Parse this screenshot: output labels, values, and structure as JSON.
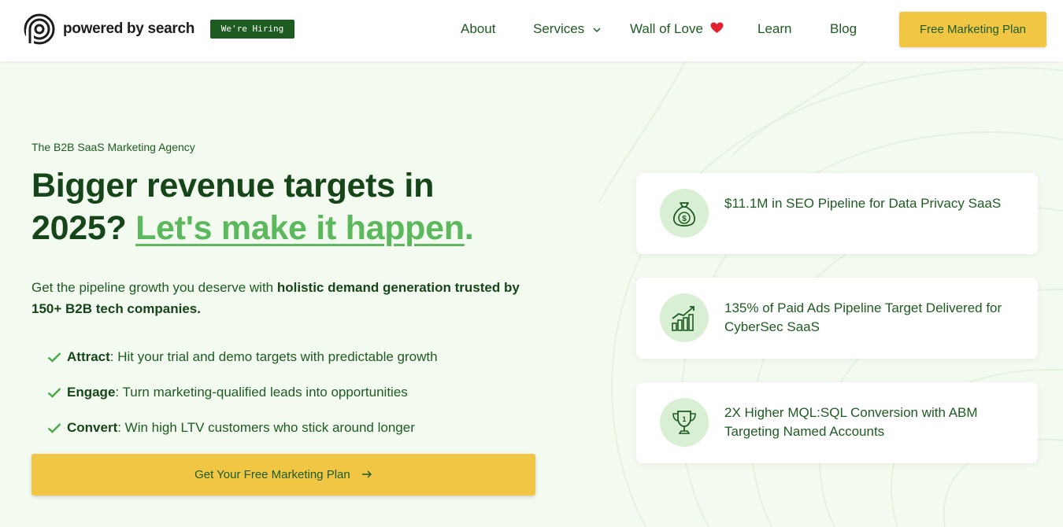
{
  "header": {
    "logo_text": "powered by search",
    "hiring_badge": "We're Hiring",
    "nav": {
      "about": "About",
      "services": "Services",
      "wall_of_love": "Wall of Love",
      "learn": "Learn",
      "blog": "Blog"
    },
    "cta_label": "Free Marketing Plan"
  },
  "hero": {
    "eyebrow": "The B2B SaaS Marketing Agency",
    "headline_line1": "Bigger revenue targets in",
    "headline_year": "2025?",
    "headline_accent": "Let's make it happen",
    "headline_dot": ".",
    "lede_plain": "Get the pipeline growth you deserve with",
    "lede_bold": "holistic demand generation trusted by 150+ B2B tech companies.",
    "bullets": [
      {
        "term": "Attract",
        "text": ": Hit your trial and demo targets with predictable growth"
      },
      {
        "term": "Engage",
        "text": ": Turn marketing-qualified leads into opportunities"
      },
      {
        "term": "Convert",
        "text": ": Win high LTV customers who stick around longer"
      }
    ],
    "cta_label": "Get Your Free Marketing Plan"
  },
  "results": [
    {
      "icon": "money-bag-icon",
      "text": "$11.1M in SEO Pipeline for Data Privacy SaaS"
    },
    {
      "icon": "growth-chart-icon",
      "text": "135% of Paid Ads Pipeline Target Delivered for CyberSec SaaS"
    },
    {
      "icon": "trophy-icon",
      "text": "2X Higher MQL:SQL Conversion with ABM Targeting Named Accounts"
    }
  ],
  "colors": {
    "brand_dark_green": "#17451a",
    "brand_green": "#1e5b21",
    "accent_green": "#5cb85c",
    "cta_yellow": "#f1c644",
    "page_background": "#f3faf0",
    "icon_circle": "#d8efd3"
  }
}
